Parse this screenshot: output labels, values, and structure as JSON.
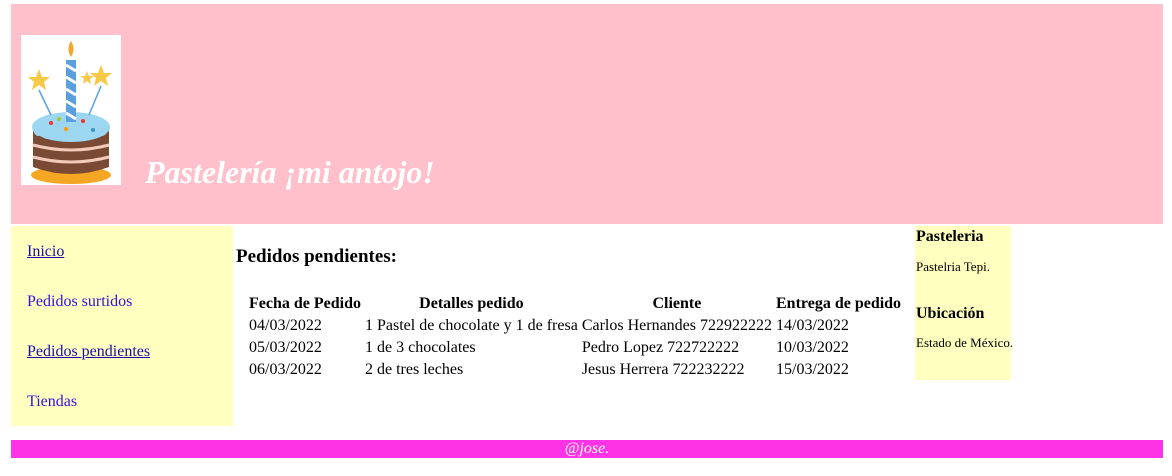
{
  "header": {
    "title": "Pastelería ¡mi antojo!",
    "logo_text": "Pastelería ¡mi antojo!"
  },
  "nav": {
    "items": [
      {
        "label": "Inicio"
      },
      {
        "label": "Pedidos surtidos"
      },
      {
        "label": "Pedidos pendientes"
      },
      {
        "label": "Tiendas"
      }
    ]
  },
  "main": {
    "heading": "Pedidos pendientes:",
    "table": {
      "headers": [
        "Fecha de Pedido",
        "Detalles pedido",
        "Cliente",
        "Entrega de pedido"
      ],
      "rows": [
        [
          "04/03/2022",
          "1 Pastel de chocolate y 1 de fresa",
          "Carlos Hernandes 722922222",
          "14/03/2022"
        ],
        [
          "05/03/2022",
          "1 de 3 chocolates",
          "Pedro Lopez 722722222",
          "10/03/2022"
        ],
        [
          "06/03/2022",
          "2 de tres leches",
          "Jesus Herrera 722232222",
          "15/03/2022"
        ]
      ]
    }
  },
  "aside": {
    "pasteleria_heading": "Pasteleria",
    "pasteleria_text": "Pastelria Tepi.",
    "ubicacion_heading": "Ubicación",
    "ubicacion_text": "Estado de México."
  },
  "footer": {
    "text": "@jose."
  },
  "colors": {
    "header_bg": "#ffc0cb",
    "sidebar_bg": "#ffffc0",
    "footer_bg": "#ff33e6",
    "link": "#1a0dab"
  }
}
